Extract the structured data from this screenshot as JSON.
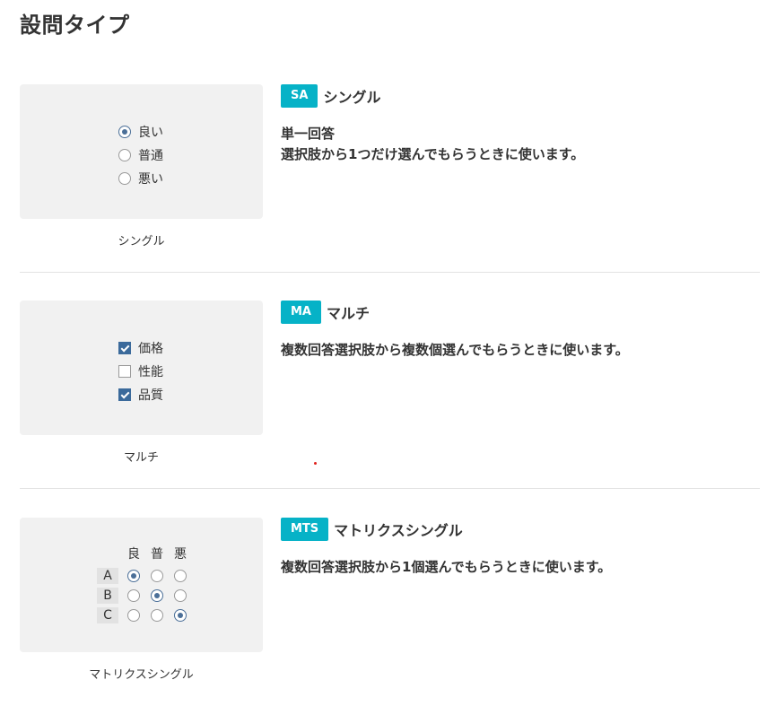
{
  "page": {
    "title": "設問タイプ"
  },
  "types": [
    {
      "badge": "SA",
      "name": "シングル",
      "desc_title": "単一回答",
      "desc": "選択肢から1つだけ選んでもらうときに使います。",
      "caption": "シングル",
      "preview": {
        "options": [
          {
            "label": "良い",
            "selected": true
          },
          {
            "label": "普通",
            "selected": false
          },
          {
            "label": "悪い",
            "selected": false
          }
        ]
      }
    },
    {
      "badge": "MA",
      "name": "マルチ",
      "desc": "複数回答選択肢から複数個選んでもらうときに使います。",
      "caption": "マルチ",
      "preview": {
        "options": [
          {
            "label": "価格",
            "checked": true
          },
          {
            "label": "性能",
            "checked": false
          },
          {
            "label": "品質",
            "checked": true
          }
        ]
      }
    },
    {
      "badge": "MTS",
      "name": "マトリクスシングル",
      "desc": "複数回答選択肢から1個選んでもらうときに使います。",
      "caption": "マトリクスシングル",
      "preview": {
        "columns": [
          "良",
          "普",
          "悪"
        ],
        "rows": [
          {
            "label": "A",
            "selected": 0
          },
          {
            "label": "B",
            "selected": 1
          },
          {
            "label": "C",
            "selected": 2
          }
        ]
      }
    }
  ],
  "colors": {
    "badge": "#06b2c7",
    "accent": "#3b6a9b",
    "marker": "#e0201b"
  }
}
